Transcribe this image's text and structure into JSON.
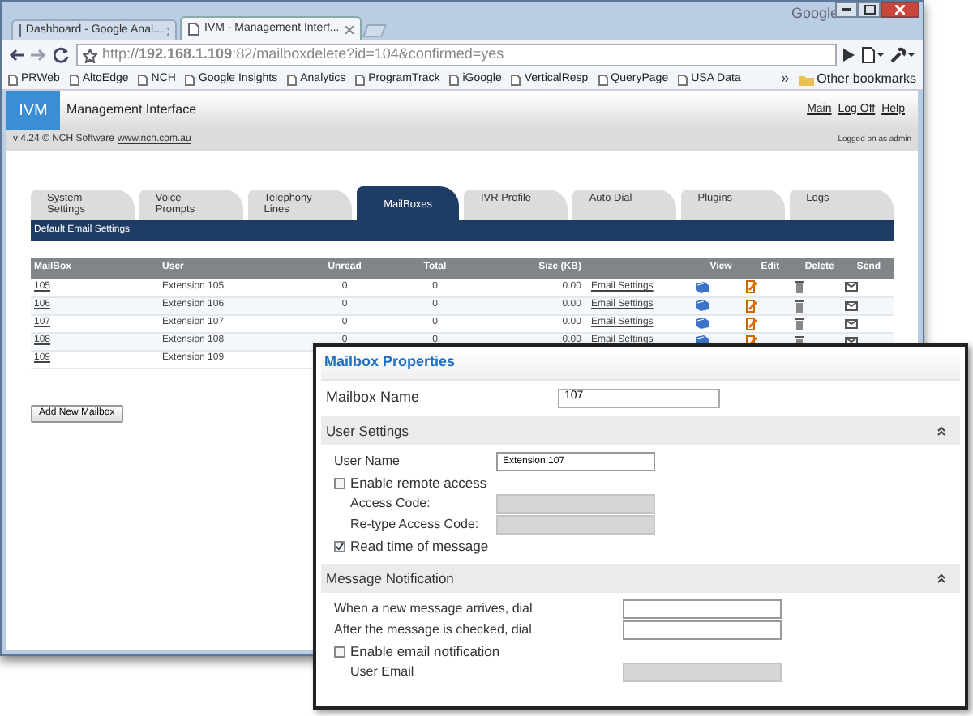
{
  "browser": {
    "tabs": [
      {
        "label": "Dashboard - Google Anal...",
        "selected": false
      },
      {
        "label": "IVM - Management Interf...",
        "selected": true
      }
    ],
    "brand": "Google",
    "address": {
      "url": "http://**192.168.1.109**:82/mailboxdelete?id=104&confirmed=yes"
    },
    "bookmarks": [
      {
        "label": "PRWeb"
      },
      {
        "label": "AltoEdge"
      },
      {
        "label": "NCH"
      },
      {
        "label": "Google Insights"
      },
      {
        "label": "Analytics"
      },
      {
        "label": "ProgramTrack"
      },
      {
        "label": "iGoogle"
      },
      {
        "label": "VerticalResp"
      },
      {
        "label": "QueryPage"
      },
      {
        "label": "USA Data"
      }
    ],
    "bookmarks_overflow": "»",
    "other_bookmarks": "Other bookmarks"
  },
  "app_header": {
    "logo": "IVM",
    "title": "Management Interface",
    "links": [
      "Main",
      "Log Off",
      "Help"
    ]
  },
  "version_bar": {
    "text": "v 4.24 © NCH Software",
    "link": "www.nch.com.au",
    "login": "Logged on as admin"
  },
  "nav_tabs": [
    {
      "label": "System Settings",
      "selected": false
    },
    {
      "label": "Voice Prompts",
      "selected": false
    },
    {
      "label": "Telephony Lines",
      "selected": false
    },
    {
      "label": "MailBoxes",
      "selected": true
    },
    {
      "label": "IVR Profile",
      "selected": false
    },
    {
      "label": "Auto Dial",
      "selected": false
    },
    {
      "label": "Plugins",
      "selected": false
    },
    {
      "label": "Logs",
      "selected": false
    }
  ],
  "sub_bar": "Default Email Settings",
  "table": {
    "columns": [
      "MailBox",
      "User",
      "Unread",
      "Total",
      "Size (KB)",
      "View",
      "Edit",
      "Delete",
      "Send"
    ],
    "rows": [
      {
        "mailbox": "105",
        "user": "Extension 105",
        "unread": "0",
        "total": "0",
        "size": "0.00",
        "link": "Email Settings"
      },
      {
        "mailbox": "106",
        "user": "Extension 106",
        "unread": "0",
        "total": "0",
        "size": "0.00",
        "link": "Email Settings"
      },
      {
        "mailbox": "107",
        "user": "Extension 107",
        "unread": "0",
        "total": "0",
        "size": "0.00",
        "link": "Email Settings"
      },
      {
        "mailbox": "108",
        "user": "Extension 108",
        "unread": "0",
        "total": "0",
        "size": "0.00",
        "link": "Email Settings"
      },
      {
        "mailbox": "109",
        "user": "Extension 109"
      }
    ]
  },
  "add_button": "Add New Mailbox",
  "properties": {
    "title": "Mailbox Properties",
    "name_field": {
      "label": "Mailbox Name",
      "value": "107"
    },
    "sections": [
      {
        "title": "User Settings",
        "fields": [
          {
            "kind": "text",
            "label": "User Name",
            "value": "Extension 107",
            "disabled": false
          },
          {
            "kind": "checkbox",
            "label": "Enable remote access",
            "checked": false
          },
          {
            "kind": "text",
            "label": "Access Code:",
            "disabled": true,
            "indent": true
          },
          {
            "kind": "text",
            "label": "Re-type Access Code:",
            "disabled": true,
            "indent": true
          },
          {
            "kind": "checkbox",
            "label": "Read time of message",
            "checked": true
          }
        ]
      },
      {
        "title": "Message Notification",
        "fields": [
          {
            "kind": "text",
            "label": "When a new message arrives, dial",
            "disabled": false
          },
          {
            "kind": "text",
            "label": "After the message is checked, dial",
            "disabled": false
          },
          {
            "kind": "checkbox",
            "label": "Enable email notification",
            "checked": false
          },
          {
            "kind": "text",
            "label": "User Email",
            "disabled": true,
            "indent": true
          }
        ]
      }
    ]
  }
}
